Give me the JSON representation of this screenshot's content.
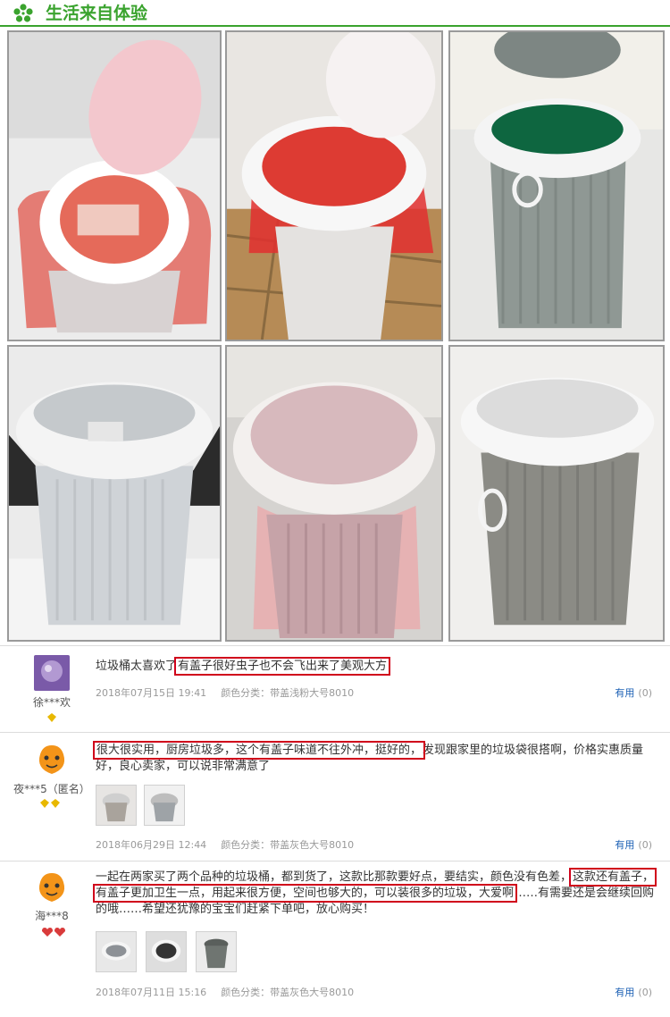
{
  "header": {
    "title": "生活来自体验",
    "icon": "flower-icon",
    "accent_color": "#3aa32e"
  },
  "photos": [
    {
      "alt": "pink bin open lid red bag"
    },
    {
      "alt": "pink-white bin open lid red bag floor"
    },
    {
      "alt": "grey bin open lid handles"
    },
    {
      "alt": "light grey bin closed black bag"
    },
    {
      "alt": "pink bin closed pink bag"
    },
    {
      "alt": "grey bin closed with handles"
    }
  ],
  "reviews": [
    {
      "text_before": "垃圾桶太喜欢了",
      "text_highlight": "有盖子很好虫子也不会飞出来了美观大方",
      "text_after": "",
      "user": "徐***欢",
      "date": "2018年07月15日 19:41",
      "category": "颜色分类：带盖浅粉大号8010",
      "useful_label": "有用",
      "useful_count": "(0)"
    },
    {
      "text_highlight": "很大很实用，厨房垃圾多，这个有盖子味道不往外冲，挺好的，",
      "text_after": "发现跟家里的垃圾袋很搭啊，价格实惠质量好，良心卖家，可以说非常满意了",
      "user": "夜***5（匿名）",
      "date": "2018年06月29日 12:44",
      "category": "颜色分类：带盖灰色大号8010",
      "useful_label": "有用",
      "useful_count": "(0)"
    },
    {
      "text_before": "一起在两家买了两个品种的垃圾桶，都到货了，这款比那款要好点，要结实，颜色没有色差，",
      "text_highlight": "这款还有盖子，有盖子更加卫生一点，用起来很方便，空间也够大的，可以装很多的垃圾，大爱啊",
      "text_after": "……有需要还是会继续回购的哦……希望还犹豫的宝宝们赶紧下单吧，放心购买！",
      "user": "海***8",
      "date": "2018年07月11日 15:16",
      "category": "颜色分类：带盖灰色大号8010",
      "useful_label": "有用",
      "useful_count": "(0)"
    }
  ]
}
